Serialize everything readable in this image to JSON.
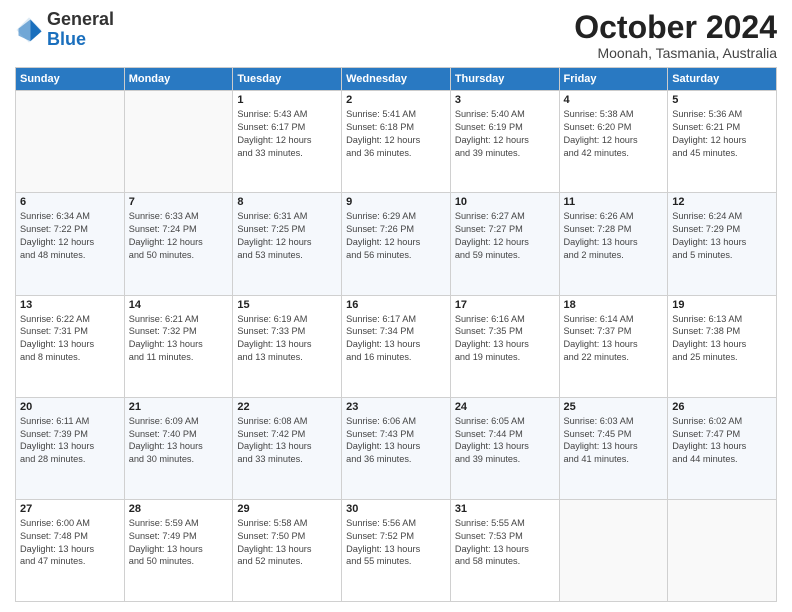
{
  "header": {
    "logo_general": "General",
    "logo_blue": "Blue",
    "month_title": "October 2024",
    "subtitle": "Moonah, Tasmania, Australia"
  },
  "weekdays": [
    "Sunday",
    "Monday",
    "Tuesday",
    "Wednesday",
    "Thursday",
    "Friday",
    "Saturday"
  ],
  "weeks": [
    [
      {
        "day": "",
        "info": ""
      },
      {
        "day": "",
        "info": ""
      },
      {
        "day": "1",
        "info": "Sunrise: 5:43 AM\nSunset: 6:17 PM\nDaylight: 12 hours\nand 33 minutes."
      },
      {
        "day": "2",
        "info": "Sunrise: 5:41 AM\nSunset: 6:18 PM\nDaylight: 12 hours\nand 36 minutes."
      },
      {
        "day": "3",
        "info": "Sunrise: 5:40 AM\nSunset: 6:19 PM\nDaylight: 12 hours\nand 39 minutes."
      },
      {
        "day": "4",
        "info": "Sunrise: 5:38 AM\nSunset: 6:20 PM\nDaylight: 12 hours\nand 42 minutes."
      },
      {
        "day": "5",
        "info": "Sunrise: 5:36 AM\nSunset: 6:21 PM\nDaylight: 12 hours\nand 45 minutes."
      }
    ],
    [
      {
        "day": "6",
        "info": "Sunrise: 6:34 AM\nSunset: 7:22 PM\nDaylight: 12 hours\nand 48 minutes."
      },
      {
        "day": "7",
        "info": "Sunrise: 6:33 AM\nSunset: 7:24 PM\nDaylight: 12 hours\nand 50 minutes."
      },
      {
        "day": "8",
        "info": "Sunrise: 6:31 AM\nSunset: 7:25 PM\nDaylight: 12 hours\nand 53 minutes."
      },
      {
        "day": "9",
        "info": "Sunrise: 6:29 AM\nSunset: 7:26 PM\nDaylight: 12 hours\nand 56 minutes."
      },
      {
        "day": "10",
        "info": "Sunrise: 6:27 AM\nSunset: 7:27 PM\nDaylight: 12 hours\nand 59 minutes."
      },
      {
        "day": "11",
        "info": "Sunrise: 6:26 AM\nSunset: 7:28 PM\nDaylight: 13 hours\nand 2 minutes."
      },
      {
        "day": "12",
        "info": "Sunrise: 6:24 AM\nSunset: 7:29 PM\nDaylight: 13 hours\nand 5 minutes."
      }
    ],
    [
      {
        "day": "13",
        "info": "Sunrise: 6:22 AM\nSunset: 7:31 PM\nDaylight: 13 hours\nand 8 minutes."
      },
      {
        "day": "14",
        "info": "Sunrise: 6:21 AM\nSunset: 7:32 PM\nDaylight: 13 hours\nand 11 minutes."
      },
      {
        "day": "15",
        "info": "Sunrise: 6:19 AM\nSunset: 7:33 PM\nDaylight: 13 hours\nand 13 minutes."
      },
      {
        "day": "16",
        "info": "Sunrise: 6:17 AM\nSunset: 7:34 PM\nDaylight: 13 hours\nand 16 minutes."
      },
      {
        "day": "17",
        "info": "Sunrise: 6:16 AM\nSunset: 7:35 PM\nDaylight: 13 hours\nand 19 minutes."
      },
      {
        "day": "18",
        "info": "Sunrise: 6:14 AM\nSunset: 7:37 PM\nDaylight: 13 hours\nand 22 minutes."
      },
      {
        "day": "19",
        "info": "Sunrise: 6:13 AM\nSunset: 7:38 PM\nDaylight: 13 hours\nand 25 minutes."
      }
    ],
    [
      {
        "day": "20",
        "info": "Sunrise: 6:11 AM\nSunset: 7:39 PM\nDaylight: 13 hours\nand 28 minutes."
      },
      {
        "day": "21",
        "info": "Sunrise: 6:09 AM\nSunset: 7:40 PM\nDaylight: 13 hours\nand 30 minutes."
      },
      {
        "day": "22",
        "info": "Sunrise: 6:08 AM\nSunset: 7:42 PM\nDaylight: 13 hours\nand 33 minutes."
      },
      {
        "day": "23",
        "info": "Sunrise: 6:06 AM\nSunset: 7:43 PM\nDaylight: 13 hours\nand 36 minutes."
      },
      {
        "day": "24",
        "info": "Sunrise: 6:05 AM\nSunset: 7:44 PM\nDaylight: 13 hours\nand 39 minutes."
      },
      {
        "day": "25",
        "info": "Sunrise: 6:03 AM\nSunset: 7:45 PM\nDaylight: 13 hours\nand 41 minutes."
      },
      {
        "day": "26",
        "info": "Sunrise: 6:02 AM\nSunset: 7:47 PM\nDaylight: 13 hours\nand 44 minutes."
      }
    ],
    [
      {
        "day": "27",
        "info": "Sunrise: 6:00 AM\nSunset: 7:48 PM\nDaylight: 13 hours\nand 47 minutes."
      },
      {
        "day": "28",
        "info": "Sunrise: 5:59 AM\nSunset: 7:49 PM\nDaylight: 13 hours\nand 50 minutes."
      },
      {
        "day": "29",
        "info": "Sunrise: 5:58 AM\nSunset: 7:50 PM\nDaylight: 13 hours\nand 52 minutes."
      },
      {
        "day": "30",
        "info": "Sunrise: 5:56 AM\nSunset: 7:52 PM\nDaylight: 13 hours\nand 55 minutes."
      },
      {
        "day": "31",
        "info": "Sunrise: 5:55 AM\nSunset: 7:53 PM\nDaylight: 13 hours\nand 58 minutes."
      },
      {
        "day": "",
        "info": ""
      },
      {
        "day": "",
        "info": ""
      }
    ]
  ]
}
